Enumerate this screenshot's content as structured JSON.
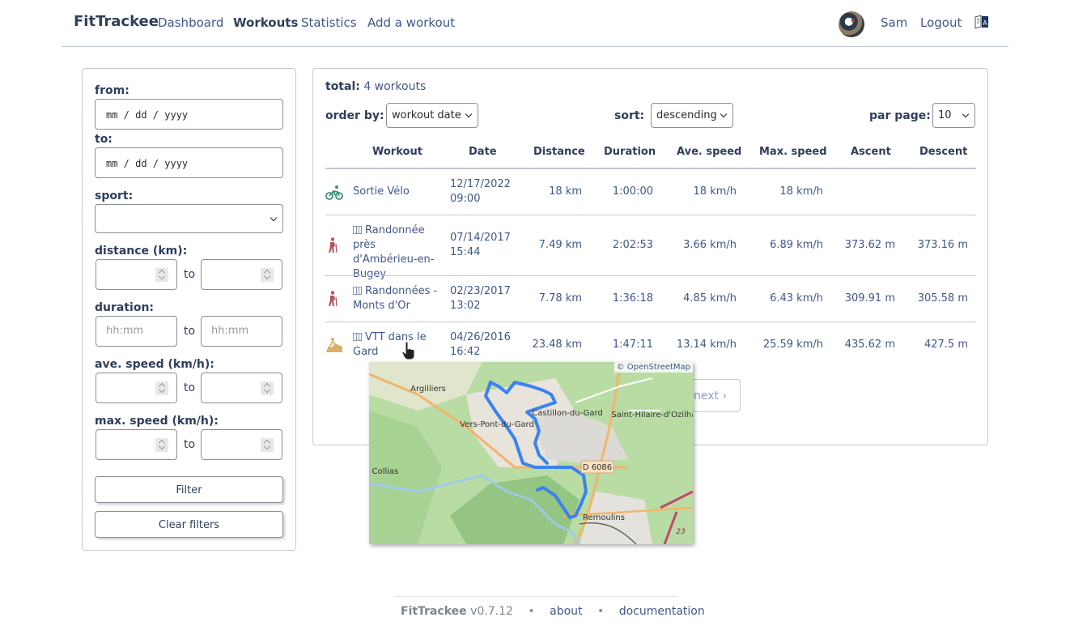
{
  "navbar": {
    "brand": "FitTrackee",
    "items": [
      {
        "label": "Dashboard",
        "active": false
      },
      {
        "label": "Workouts",
        "active": true
      },
      {
        "label": "Statistics",
        "active": false
      },
      {
        "label": "Add a workout",
        "active": false
      }
    ],
    "user": "Sam",
    "logout": "Logout",
    "icons": {
      "avatar": "user-avatar",
      "language": "translate-icon"
    }
  },
  "filters": {
    "from_label": "from:",
    "from_value": "mm / dd / yyyy",
    "to_label": "to:",
    "to_value": "mm / dd / yyyy",
    "sport_label": "sport:",
    "sport_value": "",
    "distance_label": "distance (km):",
    "duration_label": "duration:",
    "duration_placeholder": "hh:mm",
    "ave_speed_label": "ave. speed (km/h):",
    "max_speed_label": "max. speed (km/h):",
    "range_separator": "to",
    "filter_button": "Filter",
    "clear_button": "Clear filters"
  },
  "workouts": {
    "total_label": "total:",
    "total_value": "4 workouts",
    "order_by_label": "order by:",
    "order_by_value": "workout date",
    "sort_label": "sort:",
    "sort_value": "descending",
    "per_page_label": "par page:",
    "per_page_value": "10",
    "columns": [
      "Workout",
      "Date",
      "Distance",
      "Duration",
      "Ave. speed",
      "Max. speed",
      "Ascent",
      "Descent"
    ],
    "rows": [
      {
        "sport": "cycling",
        "sport_color": "#3a8f7a",
        "has_map": false,
        "title": "Sortie Vélo",
        "date": "12/17/2022",
        "time": "09:00",
        "distance": "18 km",
        "duration": "1:00:00",
        "ave_speed": "18 km/h",
        "max_speed": "18 km/h",
        "ascent": "",
        "descent": ""
      },
      {
        "sport": "hiking",
        "sport_color": "#b5545a",
        "has_map": true,
        "title": "Randonnée près d'Ambérieu-en-Bugey",
        "date": "07/14/2017",
        "time": "15:44",
        "distance": "7.49 km",
        "duration": "2:02:53",
        "ave_speed": "3.66 km/h",
        "max_speed": "6.89 km/h",
        "ascent": "373.62 m",
        "descent": "373.16 m"
      },
      {
        "sport": "hiking",
        "sport_color": "#b5545a",
        "has_map": true,
        "title": "Randonnées - Monts d'Or",
        "date": "02/23/2017",
        "time": "13:02",
        "distance": "7.78 km",
        "duration": "1:36:18",
        "ave_speed": "4.85 km/h",
        "max_speed": "6.43 km/h",
        "ascent": "309.91 m",
        "descent": "305.58 m"
      },
      {
        "sport": "mountain-biking",
        "sport_color": "#d9b066",
        "has_map": true,
        "title": "VTT dans le Gard",
        "date": "04/26/2016",
        "time": "16:42",
        "distance": "23.48 km",
        "duration": "1:47:11",
        "ave_speed": "13.14 km/h",
        "max_speed": "25.59 km/h",
        "ascent": "435.62 m",
        "descent": "427.5 m"
      }
    ],
    "pagination_next": "next",
    "map_preview": {
      "attribution": "© OpenStreetMap",
      "places": [
        "Argilliers",
        "Vers-Pont-du-Gard",
        "Castillon-du-Gard",
        "Saint-Hilaire-d'Ozilhan",
        "Collias",
        "Remoulins"
      ],
      "road_label": "D 6086",
      "motorway_label": "23",
      "route_color": "#3b82f0"
    }
  },
  "footer": {
    "brand": "FitTrackee",
    "version": "v0.7.12",
    "about": "about",
    "documentation": "documentation"
  }
}
